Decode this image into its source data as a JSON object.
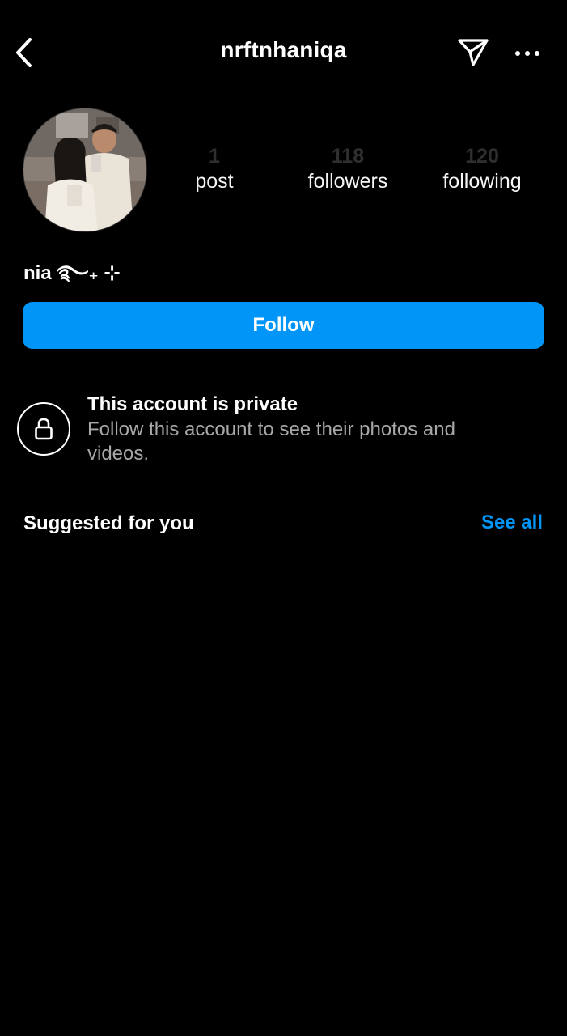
{
  "header": {
    "username": "nrftnhaniqa",
    "back_icon": "chevron-left-icon",
    "dm_icon": "paper-plane-icon",
    "more_icon": "more-horizontal-icon"
  },
  "profile": {
    "display_name": "nia ࿐₊ ⊹",
    "stats": [
      {
        "count": "1",
        "label": "post"
      },
      {
        "count": "118",
        "label": "followers"
      },
      {
        "count": "120",
        "label": "following"
      }
    ]
  },
  "follow_button": {
    "label": "Follow"
  },
  "private_notice": {
    "title": "This account is private",
    "description": "Follow this account to see their photos and videos.",
    "icon": "lock-icon"
  },
  "suggested": {
    "title": "Suggested for you",
    "see_all_label": "See all"
  },
  "colors": {
    "background": "#000000",
    "accent": "#0095f6",
    "secondary_text": "#a8a8a8",
    "dim_count": "#2f2f2f"
  }
}
